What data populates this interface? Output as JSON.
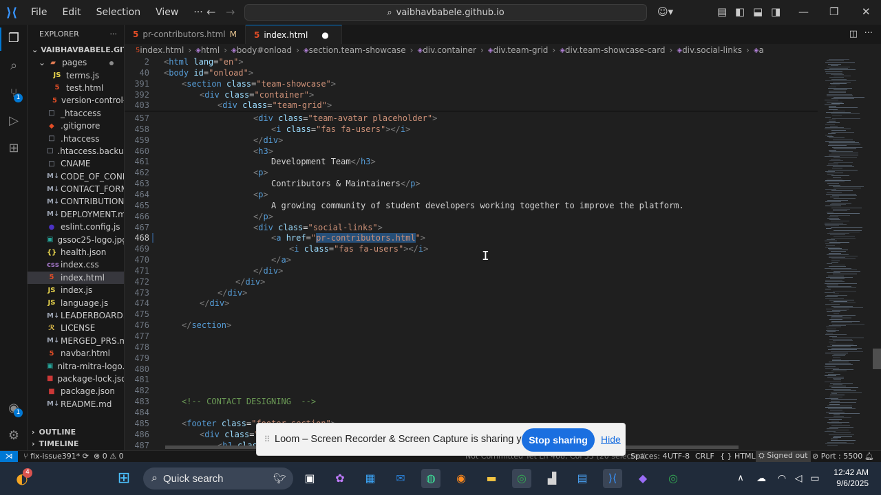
{
  "titlebar": {
    "menu": [
      "File",
      "Edit",
      "Selection",
      "View",
      "···"
    ],
    "command_center": "vaibhavbabele.github.io"
  },
  "activity_badges": {
    "source_control": "1",
    "accounts": "1"
  },
  "explorer": {
    "title": "EXPLORER",
    "more": "···",
    "root": "VAIBHAVBABELE.GITHUB.IO",
    "items": [
      {
        "icon": "folder",
        "label": "pages",
        "indent": 2,
        "color": "#e07b53",
        "modified": true
      },
      {
        "icon": "JS",
        "label": "terms.js",
        "indent": 3,
        "color": "#e8d44d"
      },
      {
        "icon": "5",
        "label": "test.html",
        "indent": 3,
        "color": "#e44d26"
      },
      {
        "icon": "5",
        "label": "version-control-...",
        "indent": 3,
        "color": "#e44d26"
      },
      {
        "icon": "□",
        "label": "_htaccess",
        "indent": 1,
        "color": "#9da5b4"
      },
      {
        "icon": "◆",
        "label": ".gitignore",
        "indent": 1,
        "color": "#e44d26"
      },
      {
        "icon": "□",
        "label": ".htaccess",
        "indent": 1,
        "color": "#9da5b4"
      },
      {
        "icon": "□",
        "label": ".htaccess.backup",
        "indent": 1,
        "color": "#9da5b4"
      },
      {
        "icon": "□",
        "label": "CNAME",
        "indent": 1,
        "color": "#9da5b4"
      },
      {
        "icon": "M↓",
        "label": "CODE_OF_COND...",
        "indent": 1,
        "color": "#9da5b4"
      },
      {
        "icon": "M↓",
        "label": "CONTACT_FORM_...",
        "indent": 1,
        "color": "#9da5b4"
      },
      {
        "icon": "M↓",
        "label": "CONTRIBUTION....",
        "indent": 1,
        "color": "#9da5b4"
      },
      {
        "icon": "M↓",
        "label": "DEPLOYMENT.md",
        "indent": 1,
        "color": "#9da5b4"
      },
      {
        "icon": "●",
        "label": "eslint.config.js",
        "indent": 1,
        "color": "#4b32c3"
      },
      {
        "icon": "▣",
        "label": "gssoc25-logo.jpg",
        "indent": 1,
        "color": "#26a69a"
      },
      {
        "icon": "{}",
        "label": "health.json",
        "indent": 1,
        "color": "#e8d44d"
      },
      {
        "icon": "css",
        "label": "index.css",
        "indent": 1,
        "color": "#a074c4"
      },
      {
        "icon": "5",
        "label": "index.html",
        "indent": 1,
        "color": "#e44d26",
        "selected": true
      },
      {
        "icon": "JS",
        "label": "index.js",
        "indent": 1,
        "color": "#e8d44d"
      },
      {
        "icon": "JS",
        "label": "language.js",
        "indent": 1,
        "color": "#e8d44d"
      },
      {
        "icon": "M↓",
        "label": "LEADERBOARD.md",
        "indent": 1,
        "color": "#9da5b4"
      },
      {
        "icon": "ℛ",
        "label": "LICENSE",
        "indent": 1,
        "color": "#e8c44d"
      },
      {
        "icon": "M↓",
        "label": "MERGED_PRS.md",
        "indent": 1,
        "color": "#9da5b4"
      },
      {
        "icon": "5",
        "label": "navbar.html",
        "indent": 1,
        "color": "#e44d26"
      },
      {
        "icon": "▣",
        "label": "nitra-mitra-logo.p...",
        "indent": 1,
        "color": "#26a69a"
      },
      {
        "icon": "■",
        "label": "package-lock.json",
        "indent": 1,
        "color": "#cb3837"
      },
      {
        "icon": "■",
        "label": "package.json",
        "indent": 1,
        "color": "#cb3837"
      },
      {
        "icon": "M↓",
        "label": "README.md",
        "indent": 1,
        "color": "#9da5b4"
      }
    ],
    "outline": "OUTLINE",
    "timeline": "TIMELINE"
  },
  "tabs": [
    {
      "label": "pr-contributors.html",
      "status": "M",
      "active": false
    },
    {
      "label": "index.html",
      "status": "●",
      "active": true
    }
  ],
  "breadcrumb": [
    "index.html",
    "html",
    "body#onload",
    "section.team-showcase",
    "div.container",
    "div.team-grid",
    "div.team-showcase-card",
    "div.social-links",
    "a"
  ],
  "editor": {
    "sticky": [
      {
        "n": "2",
        "indent": 0,
        "code": [
          [
            "tg",
            "<"
          ],
          [
            "tn",
            "html"
          ],
          [
            "at",
            " lang"
          ],
          [
            "tx",
            "="
          ],
          [
            "st",
            "\"en\""
          ],
          [
            "tg",
            ">"
          ]
        ]
      },
      {
        "n": "40",
        "indent": 0,
        "code": [
          [
            "tg",
            "<"
          ],
          [
            "tn",
            "body"
          ],
          [
            "at",
            " id"
          ],
          [
            "tx",
            "="
          ],
          [
            "st",
            "\"onload\""
          ],
          [
            "tg",
            ">"
          ]
        ]
      },
      {
        "n": "391",
        "indent": 1,
        "code": [
          [
            "tg",
            "<"
          ],
          [
            "tn",
            "section"
          ],
          [
            "at",
            " class"
          ],
          [
            "tx",
            "="
          ],
          [
            "st",
            "\"team-showcase\""
          ],
          [
            "tg",
            ">"
          ]
        ]
      },
      {
        "n": "392",
        "indent": 2,
        "code": [
          [
            "tg",
            "<"
          ],
          [
            "tn",
            "div"
          ],
          [
            "at",
            " class"
          ],
          [
            "tx",
            "="
          ],
          [
            "st",
            "\"container\""
          ],
          [
            "tg",
            ">"
          ]
        ]
      },
      {
        "n": "403",
        "indent": 3,
        "code": [
          [
            "tg",
            "<"
          ],
          [
            "tn",
            "div"
          ],
          [
            "at",
            " class"
          ],
          [
            "tx",
            "="
          ],
          [
            "st",
            "\"team-grid\""
          ],
          [
            "tg",
            ">"
          ]
        ]
      }
    ],
    "lines": [
      {
        "n": "457",
        "indent": 5,
        "code": [
          [
            "tg",
            "<"
          ],
          [
            "tn",
            "div"
          ],
          [
            "at",
            " class"
          ],
          [
            "tx",
            "="
          ],
          [
            "st",
            "\"team-avatar placeholder\""
          ],
          [
            "tg",
            ">"
          ]
        ]
      },
      {
        "n": "458",
        "indent": 6,
        "code": [
          [
            "tg",
            "<"
          ],
          [
            "tn",
            "i"
          ],
          [
            "at",
            " class"
          ],
          [
            "tx",
            "="
          ],
          [
            "st",
            "\"fas fa-users\""
          ],
          [
            "tg",
            "></"
          ],
          [
            "tn",
            "i"
          ],
          [
            "tg",
            ">"
          ]
        ]
      },
      {
        "n": "459",
        "indent": 5,
        "code": [
          [
            "tg",
            "</"
          ],
          [
            "tn",
            "div"
          ],
          [
            "tg",
            ">"
          ]
        ]
      },
      {
        "n": "460",
        "indent": 5,
        "code": [
          [
            "tg",
            "<"
          ],
          [
            "tn",
            "h3"
          ],
          [
            "tg",
            ">"
          ]
        ]
      },
      {
        "n": "461",
        "indent": 6,
        "code": [
          [
            "tx",
            "Development Team"
          ],
          [
            "tg",
            "</"
          ],
          [
            "tn",
            "h3"
          ],
          [
            "tg",
            ">"
          ]
        ]
      },
      {
        "n": "462",
        "indent": 5,
        "code": [
          [
            "tg",
            "<"
          ],
          [
            "tn",
            "p"
          ],
          [
            "tg",
            ">"
          ]
        ]
      },
      {
        "n": "463",
        "indent": 6,
        "code": [
          [
            "tx",
            "Contributors & Maintainers"
          ],
          [
            "tg",
            "</"
          ],
          [
            "tn",
            "p"
          ],
          [
            "tg",
            ">"
          ]
        ]
      },
      {
        "n": "464",
        "indent": 5,
        "code": [
          [
            "tg",
            "<"
          ],
          [
            "tn",
            "p"
          ],
          [
            "tg",
            ">"
          ]
        ]
      },
      {
        "n": "465",
        "indent": 6,
        "code": [
          [
            "tx",
            "A growing community of student developers working together to improve the platform."
          ]
        ]
      },
      {
        "n": "466",
        "indent": 5,
        "code": [
          [
            "tg",
            "</"
          ],
          [
            "tn",
            "p"
          ],
          [
            "tg",
            ">"
          ]
        ]
      },
      {
        "n": "467",
        "indent": 5,
        "code": [
          [
            "tg",
            "<"
          ],
          [
            "tn",
            "div"
          ],
          [
            "at",
            " class"
          ],
          [
            "tx",
            "="
          ],
          [
            "st",
            "\"social-links\""
          ],
          [
            "tg",
            ">"
          ]
        ]
      },
      {
        "n": "468",
        "indent": 6,
        "current": true,
        "code": [
          [
            "tg",
            "<"
          ],
          [
            "tn",
            "a"
          ],
          [
            "at",
            " href"
          ],
          [
            "tx",
            "="
          ],
          [
            "st",
            "\""
          ],
          [
            "sel",
            "pr-contributors.html"
          ],
          [
            "st",
            "\""
          ],
          [
            "tg",
            ">"
          ]
        ]
      },
      {
        "n": "469",
        "indent": 7,
        "code": [
          [
            "tg",
            "<"
          ],
          [
            "tn",
            "i"
          ],
          [
            "at",
            " class"
          ],
          [
            "tx",
            "="
          ],
          [
            "st",
            "\"fas fa-users\""
          ],
          [
            "tg",
            "></"
          ],
          [
            "tn",
            "i"
          ],
          [
            "tg",
            ">"
          ]
        ]
      },
      {
        "n": "470",
        "indent": 6,
        "code": [
          [
            "tg",
            "</"
          ],
          [
            "tn",
            "a"
          ],
          [
            "tg",
            ">"
          ]
        ]
      },
      {
        "n": "471",
        "indent": 5,
        "code": [
          [
            "tg",
            "</"
          ],
          [
            "tn",
            "div"
          ],
          [
            "tg",
            ">"
          ]
        ]
      },
      {
        "n": "472",
        "indent": 4,
        "code": [
          [
            "tg",
            "</"
          ],
          [
            "tn",
            "div"
          ],
          [
            "tg",
            ">"
          ]
        ]
      },
      {
        "n": "473",
        "indent": 3,
        "code": [
          [
            "tg",
            "</"
          ],
          [
            "tn",
            "div"
          ],
          [
            "tg",
            ">"
          ]
        ]
      },
      {
        "n": "474",
        "indent": 2,
        "code": [
          [
            "tg",
            "</"
          ],
          [
            "tn",
            "div"
          ],
          [
            "tg",
            ">"
          ]
        ]
      },
      {
        "n": "475",
        "indent": 0,
        "code": []
      },
      {
        "n": "476",
        "indent": 1,
        "code": [
          [
            "tg",
            "</"
          ],
          [
            "tn",
            "section"
          ],
          [
            "tg",
            ">"
          ]
        ]
      },
      {
        "n": "477",
        "indent": 0,
        "code": []
      },
      {
        "n": "478",
        "indent": 0,
        "code": []
      },
      {
        "n": "479",
        "indent": 0,
        "code": []
      },
      {
        "n": "480",
        "indent": 0,
        "code": []
      },
      {
        "n": "481",
        "indent": 0,
        "code": []
      },
      {
        "n": "482",
        "indent": 0,
        "code": []
      },
      {
        "n": "483",
        "indent": 1,
        "code": [
          [
            "cm",
            "<!-- CONTACT DESIGNING  -->"
          ]
        ]
      },
      {
        "n": "484",
        "indent": 0,
        "code": []
      },
      {
        "n": "485",
        "indent": 1,
        "code": [
          [
            "tg",
            "<"
          ],
          [
            "tn",
            "footer"
          ],
          [
            "at",
            " class"
          ],
          [
            "tx",
            "="
          ],
          [
            "st",
            "\"footer-section\""
          ],
          [
            "tg",
            ">"
          ]
        ]
      },
      {
        "n": "486",
        "indent": 2,
        "code": [
          [
            "tg",
            "<"
          ],
          [
            "tn",
            "div"
          ],
          [
            "at",
            " class"
          ],
          [
            "tx",
            "="
          ],
          [
            "st",
            "\"c"
          ]
        ]
      },
      {
        "n": "487",
        "indent": 3,
        "code": [
          [
            "tg",
            "<"
          ],
          [
            "tn",
            "h1"
          ],
          [
            "at",
            " class"
          ]
        ]
      }
    ]
  },
  "statusbar": {
    "branch": "fix-issue391*",
    "problems": "⊗ 0  ⚠ 0",
    "hidden_center": "Not Committed Yet    Ln 468, Col 33 (20 selected)",
    "spaces": "Spaces: 4",
    "encoding": "UTF-8",
    "eol": "CRLF",
    "language": "{ } HTML",
    "signed_out": "Signed out",
    "port": "Port : 5500"
  },
  "loom": {
    "message": "Loom – Screen Recorder & Screen Capture is sharing your screen.",
    "stop": "Stop sharing",
    "hide": "Hide"
  },
  "taskbar": {
    "search": "Quick search",
    "weather_badge": "4",
    "time": "12:42 AM",
    "date": "9/6/2025"
  }
}
